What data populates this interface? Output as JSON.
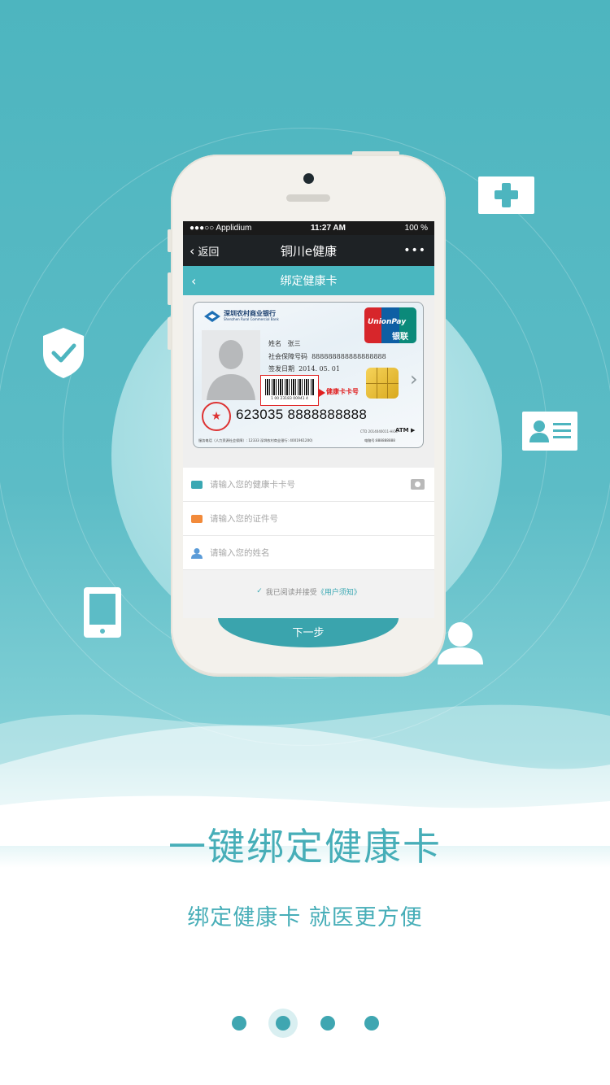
{
  "status_bar": {
    "carrier": "●●●○○ Applidium",
    "time": "11:27 AM",
    "battery": "100 %"
  },
  "nav": {
    "back_label": "返回",
    "title": "铜川e健康",
    "more": "•••"
  },
  "subheader": {
    "title": "绑定健康卡"
  },
  "card": {
    "bank_name_cn": "深圳农村商业银行",
    "bank_name_en": "Shenzhen Rural Commercial Bank",
    "unionpay_en": "UnionPay",
    "unionpay_cn": "银联",
    "name_label": "姓名",
    "name_value": "张三",
    "ssn_label": "社会保障号码",
    "ssn_value": "888888888888888888",
    "date_label": "签发日期",
    "date_value": "2014. 05. 01",
    "barcode_number": "1 00 23183 00941 4",
    "health_card_tag": "健康卡卡号",
    "card_number": "623035 8888888888",
    "footer_left": "服务电话（人力资源社会保障）: 12333   深圳农村商业银行: 4001961200）",
    "footer_right": "电脑号:888888888",
    "cto": "CTD 2014040011-HiCo",
    "atm": "ATM ▶"
  },
  "form": {
    "card_placeholder": "请输入您的健康卡卡号",
    "id_placeholder": "请输入您的证件号",
    "name_placeholder": "请输入您的姓名",
    "agree_prefix": "我已阅读并接受",
    "agree_link": "《用户须知》"
  },
  "next_button": {
    "label": "下一步"
  },
  "headline": "一键绑定健康卡",
  "subline": "绑定健康卡  就医更方便",
  "pager": {
    "count": 4,
    "active_index": 1
  },
  "colors": {
    "primary": "#47aeb8",
    "background_top": "#4db5bf",
    "nav_dark": "#1e2225"
  },
  "floating_icons": [
    "medical-cross-icon",
    "shield-check-icon",
    "id-card-icon",
    "mobile-phone-icon",
    "user-icon"
  ]
}
